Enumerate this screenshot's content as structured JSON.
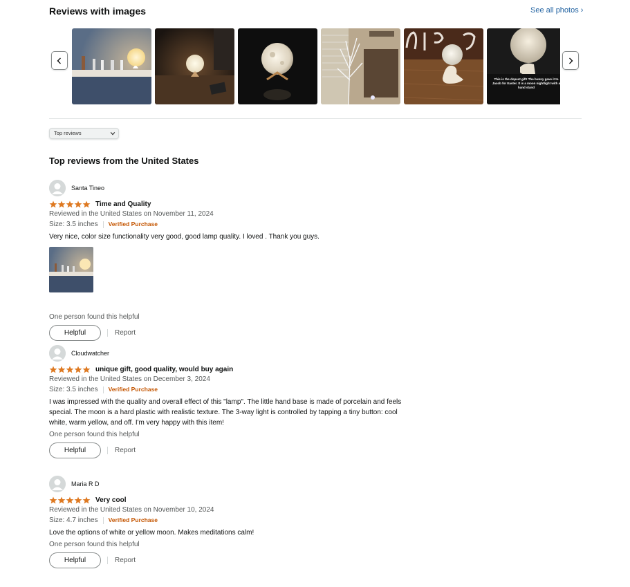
{
  "gallery": {
    "title": "Reviews with images",
    "see_all": "See all photos",
    "thumb_caption": "This is the dopest gift! The bunny gave it to Jacob for Easter. It is a moon nightlight with a hand stand"
  },
  "sort": {
    "selected": "Top reviews"
  },
  "reviews_heading": "Top reviews from the United States",
  "reviews": [
    {
      "name": "Santa Tineo",
      "rating": 5,
      "title": "Time and Quality",
      "date": "Reviewed in the United States on November 11, 2024",
      "size": "Size: 3.5 inches",
      "verified": "Verified Purchase",
      "body": "Very nice, color size functionality very good, good lamp quality. I loved . Thank you guys.",
      "helpful_count": "One person found this helpful",
      "helpful": "Helpful",
      "report": "Report"
    },
    {
      "name": "Cloudwatcher",
      "rating": 5,
      "title": "unique gift, good quality, would buy again",
      "date": "Reviewed in the United States on December 3, 2024",
      "size": "Size: 3.5 inches",
      "verified": "Verified Purchase",
      "body": "I was impressed with the quality and overall effect of this \"lamp\". The little hand base is made of porcelain and feels special. The moon is a hard plastic with realistic texture. The 3-way light is controlled by tapping a tiny button: cool white, warm yellow, and off. I'm very happy with this item!",
      "helpful_count": "One person found this helpful",
      "helpful": "Helpful",
      "report": "Report"
    },
    {
      "name": "Maria R D",
      "rating": 5,
      "title": "Very cool",
      "date": "Reviewed in the United States on November 10, 2024",
      "size": "Size: 4.7 inches",
      "verified": "Verified Purchase",
      "body": "Love the options of white or yellow moon. Makes meditations calm!",
      "helpful_count": "One person found this helpful",
      "helpful": "Helpful",
      "report": "Report"
    }
  ],
  "colors": {
    "link": "#2162a1",
    "star": "#de7921",
    "verified": "#c45500"
  }
}
